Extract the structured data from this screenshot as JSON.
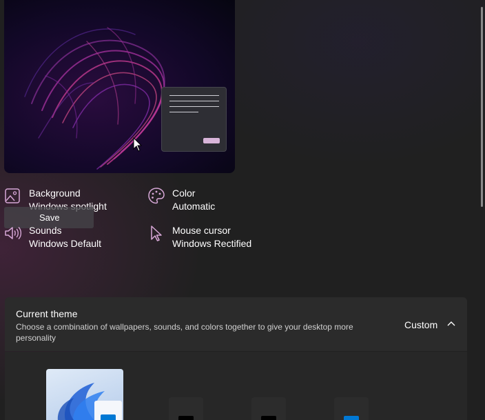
{
  "properties": {
    "background": {
      "title": "Background",
      "value": "Windows spotlight"
    },
    "color": {
      "title": "Color",
      "value": "Automatic"
    },
    "sounds": {
      "title": "Sounds",
      "value": "Windows Default"
    },
    "mouse_cursor": {
      "title": "Mouse cursor",
      "value": "Windows Rectified"
    }
  },
  "tooltip": {
    "save_label": "Save"
  },
  "current_theme": {
    "title": "Current theme",
    "description": "Choose a combination of wallpapers, sounds, and colors together to give your desktop more personality",
    "selected_value": "Custom",
    "expanded": true
  },
  "theme_thumbnails": [
    {
      "name": "windows-light-bloom",
      "accent": "#0078d4"
    },
    {
      "name": "dark-theme-1",
      "accent": "#000000"
    },
    {
      "name": "dark-theme-2",
      "accent": "#000000"
    },
    {
      "name": "blue-theme",
      "accent": "#0078d4"
    }
  ],
  "icons": {
    "background": "picture-icon",
    "color": "palette-icon",
    "sounds": "speaker-icon",
    "mouse_cursor": "pointer-icon",
    "collapse": "chevron-up-icon"
  },
  "colors": {
    "accent_pink": "#d8a8d8",
    "panel": "#2b2b2b",
    "page": "#202020"
  }
}
